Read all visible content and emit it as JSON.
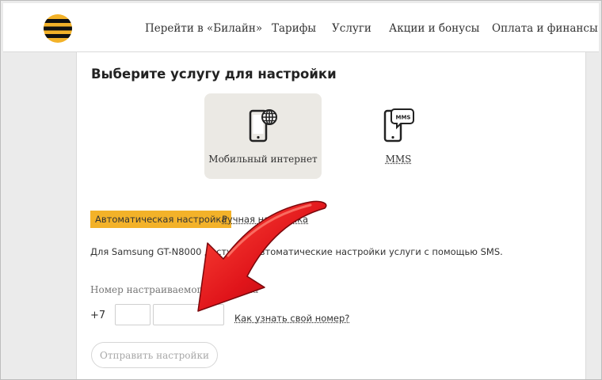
{
  "colors": {
    "brand_yellow": "#f3b229",
    "arrow_red": "#e0141a",
    "tile_active_bg": "#ebe9e4"
  },
  "header": {
    "logo_icon": "beeline-logo-icon",
    "nav": [
      {
        "label": "Перейти в «Билайн»"
      },
      {
        "label": "Тарифы"
      },
      {
        "label": "Услуги"
      },
      {
        "label": "Акции и бонусы"
      },
      {
        "label": "Оплата и финансы"
      }
    ]
  },
  "main": {
    "title": "Выберите услугу для настройки",
    "services": [
      {
        "label": "Мобильный интернет",
        "icon": "phone-globe-icon",
        "active": true
      },
      {
        "label": "MMS",
        "icon": "phone-mms-icon",
        "active": false
      }
    ],
    "tabs": {
      "auto": "Автоматическая настройка",
      "manual": "Ручная настройка"
    },
    "description": "Для Samsung GT-N8000 доступны автоматические настройки услуги с помощью SMS.",
    "phone": {
      "label": "Номер настраиваемого телефона",
      "prefix": "+7",
      "code_value": "",
      "number_value": ""
    },
    "help_link": "Как узнать свой номер?",
    "submit_label": "Отправить настройки"
  },
  "overlay": {
    "arrow_icon": "red-arrow-icon"
  }
}
